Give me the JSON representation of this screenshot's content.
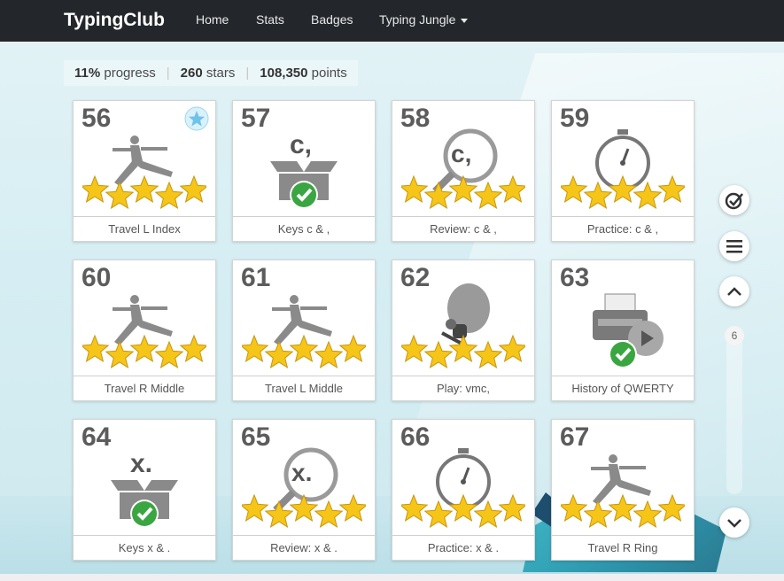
{
  "app": {
    "logo": "TypingClub"
  },
  "nav": {
    "items": [
      "Home",
      "Stats",
      "Badges"
    ],
    "dropdown_label": "Typing Jungle"
  },
  "progress": {
    "percent": "11%",
    "percent_label": "progress",
    "stars": "260",
    "stars_label": "stars",
    "points": "108,350",
    "points_label": "points"
  },
  "lessons": [
    {
      "number": "56",
      "label": "Travel L Index",
      "icon": "yoga-lunge-icon",
      "stars": 5,
      "badge": "star-medal-icon"
    },
    {
      "number": "57",
      "label": "Keys c & ,",
      "icon": "open-box-check-icon",
      "glyph": "c,",
      "stars": 0
    },
    {
      "number": "58",
      "label": "Review: c & ,",
      "icon": "magnifier-icon",
      "glyph": "c,",
      "stars": 5
    },
    {
      "number": "59",
      "label": "Practice: c & ,",
      "icon": "stopwatch-icon",
      "stars": 5
    },
    {
      "number": "60",
      "label": "Travel R Middle",
      "icon": "yoga-lunge-icon",
      "stars": 5
    },
    {
      "number": "61",
      "label": "Travel L Middle",
      "icon": "yoga-lunge-icon",
      "stars": 5
    },
    {
      "number": "62",
      "label": "Play: vmc,",
      "icon": "balloon-game-icon",
      "stars": 5
    },
    {
      "number": "63",
      "label": "History of QWERTY",
      "icon": "typewriter-video-icon",
      "stars": 0
    },
    {
      "number": "64",
      "label": "Keys x & .",
      "icon": "open-box-check-icon",
      "glyph": "x.",
      "stars": 0
    },
    {
      "number": "65",
      "label": "Review: x & .",
      "icon": "magnifier-icon",
      "glyph": "x.",
      "stars": 5
    },
    {
      "number": "66",
      "label": "Practice: x & .",
      "icon": "stopwatch-icon",
      "stars": 5
    },
    {
      "number": "67",
      "label": "Travel R Ring",
      "icon": "yoga-lunge-icon",
      "stars": 5
    }
  ],
  "side": {
    "page": "6"
  },
  "colors": {
    "topbar": "#23272b",
    "star": "#f5c518",
    "check": "#3aa641"
  }
}
